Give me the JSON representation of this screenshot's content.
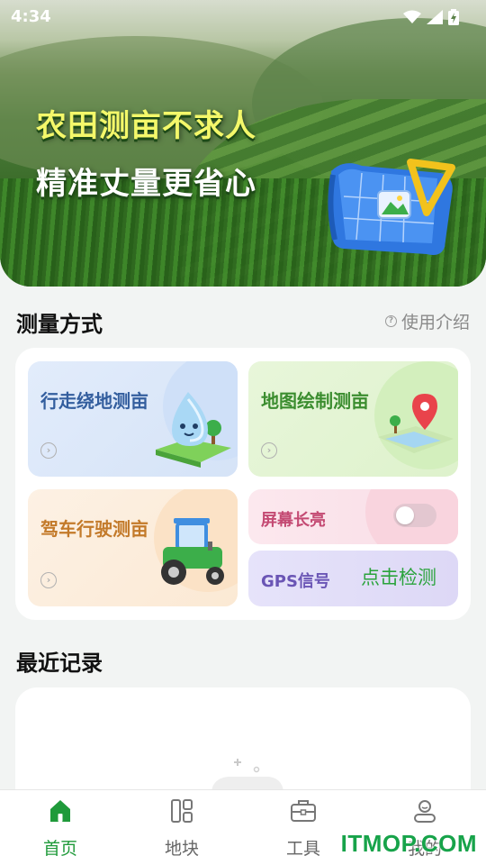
{
  "status_bar": {
    "time": "4:34"
  },
  "banner": {
    "line1": "农田测亩不求人",
    "line2": "精准丈量更省心"
  },
  "methods_section": {
    "title": "测量方式",
    "help_label": "使用介绍",
    "tiles": {
      "walk": "行走绕地测亩",
      "map": "地图绘制测亩",
      "drive": "驾车行驶测亩",
      "screen_on": "屏幕长亮",
      "gps": "GPS信号",
      "gps_action": "点击检测"
    },
    "screen_on_enabled": false
  },
  "recent_section": {
    "title": "最近记录"
  },
  "tabs": [
    {
      "label": "首页",
      "icon": "home-icon",
      "active": true
    },
    {
      "label": "地块",
      "icon": "plots-icon",
      "active": false
    },
    {
      "label": "工具",
      "icon": "toolbox-icon",
      "active": false
    },
    {
      "label": "我的",
      "icon": "profile-icon",
      "active": false
    }
  ],
  "watermark": "ITMOP.COM",
  "colors": {
    "accent": "#1f9a3a",
    "background": "#f2f4f3"
  }
}
